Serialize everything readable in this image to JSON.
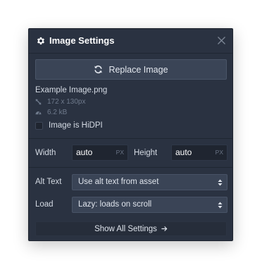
{
  "panel": {
    "title": "Image Settings",
    "title_icon": "gear-icon",
    "close_icon": "close-icon"
  },
  "replace": {
    "label": "Replace Image",
    "icon": "refresh-icon"
  },
  "asset": {
    "filename": "Example Image.png",
    "dimensions": "172 x 130px",
    "dimensions_icon": "resize-icon",
    "filesize": "6.2 kB",
    "filesize_icon": "gauge-icon"
  },
  "hidpi": {
    "label": "Image is HiDPI",
    "checked": false
  },
  "size": {
    "width_label": "Width",
    "width_value": "auto",
    "width_unit": "PX",
    "height_label": "Height",
    "height_value": "auto",
    "height_unit": "PX"
  },
  "alt": {
    "label": "Alt Text",
    "value": "Use alt text from asset"
  },
  "load": {
    "label": "Load",
    "value": "Lazy: loads on scroll"
  },
  "footer": {
    "show_all_label": "Show All Settings",
    "show_all_icon": "arrow-right-icon"
  },
  "colors": {
    "panel_bg": "#2a3241",
    "button_bg": "#3a4456",
    "input_bg": "#1f2530",
    "text": "#d5dbe4",
    "muted": "#6f7a8c"
  }
}
